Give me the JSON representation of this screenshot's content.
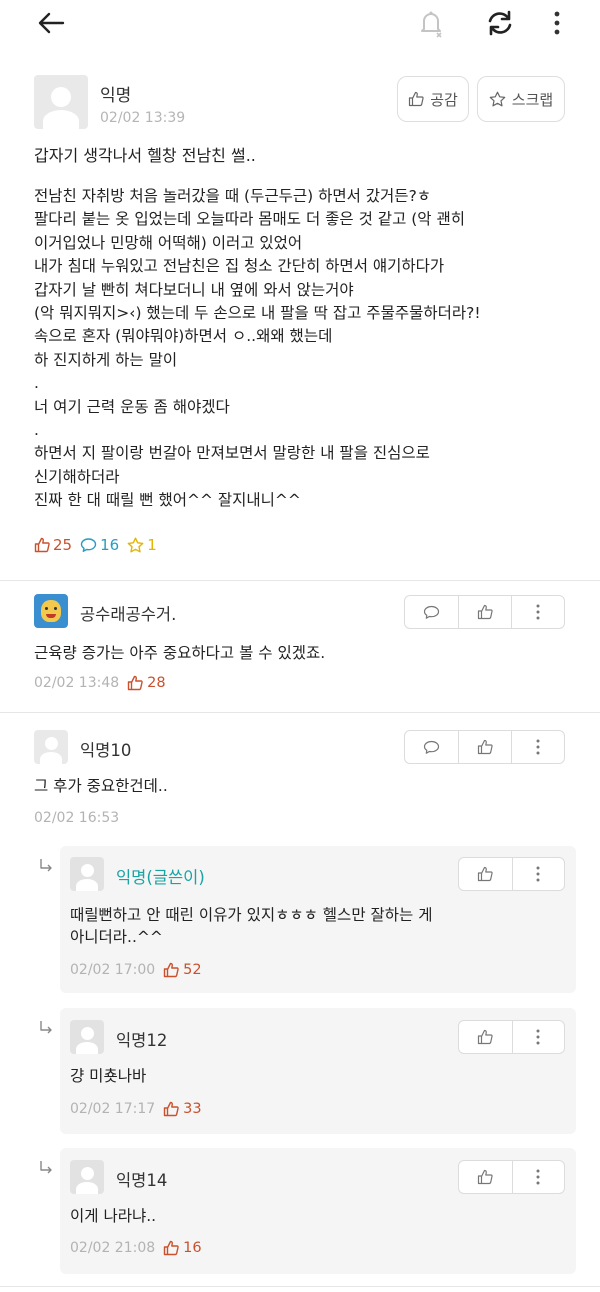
{
  "topbar": {
    "back_icon": "arrow-left-icon",
    "bell_icon": "bell-off-icon",
    "refresh_icon": "refresh-icon",
    "more_icon": "vertical-dots-icon"
  },
  "post": {
    "author": "익명",
    "time": "02/02 13:39",
    "empathy_label": "공감",
    "scrap_label": "스크랩",
    "title": "갑자기 생각나서 헬창 전남친 썰..",
    "body": [
      "전남친 자취방 처음 놀러갔을 때 (두근두근) 하면서 갔거든?ㅎ",
      "팔다리 붙는 옷 입었는데 오늘따라 몸매도 더 좋은 것 같고 (악 괜히",
      "이거입었나 민망해 어떡해) 이러고 있었어",
      "내가 침대 누워있고 전남친은 집 청소 간단히 하면서 얘기하다가",
      "갑자기 날 빤히 쳐다보더니 내 옆에 와서 앉는거야",
      "(악 뭐지뭐지>‹) 했는데 두 손으로 내 팔을 딱 잡고 주물주물하더라?!",
      "속으로 혼자 (뭐야뭐야)하면서 ㅇ..왜왜 했는데",
      "하 진지하게 하는 말이",
      ".",
      "너 여기 근력 운동 좀 해야겠다",
      ".",
      "하면서 지 팔이랑 번갈아 만져보면서 말랑한 내 팔을 진심으로",
      "신기해하더라",
      "진짜 한 대 때릴 뻔 했어^^ 잘지내니^^"
    ],
    "likes": "25",
    "comments": "16",
    "scraps": "1"
  },
  "colors": {
    "like": "#c9512d",
    "comment": "#2a9bc1",
    "scrap": "#e4b400",
    "op_name": "#1aa3a3"
  },
  "comments": [
    {
      "name": "공수래공수거.",
      "text": "근육량 증가는 아주 중요하다고 볼 수 있겠죠.",
      "time": "02/02 13:48",
      "likes": "28"
    },
    {
      "name": "익명10",
      "text": "그 후가 중요한건데..",
      "time": "02/02 16:53"
    }
  ],
  "replies": [
    {
      "name": "익명(글쓴이)",
      "text1": "때릴뻔하고 안 때린 이유가 있지ㅎㅎㅎ 헬스만 잘하는 게",
      "text2": "아니더라..^^",
      "time": "02/02 17:00",
      "likes": "52"
    },
    {
      "name": "익명12",
      "text1": "걍 미춋나바",
      "time": "02/02 17:17",
      "likes": "33"
    },
    {
      "name": "익명14",
      "text1": "이게 나라냐..",
      "time": "02/02 21:08",
      "likes": "16"
    }
  ]
}
